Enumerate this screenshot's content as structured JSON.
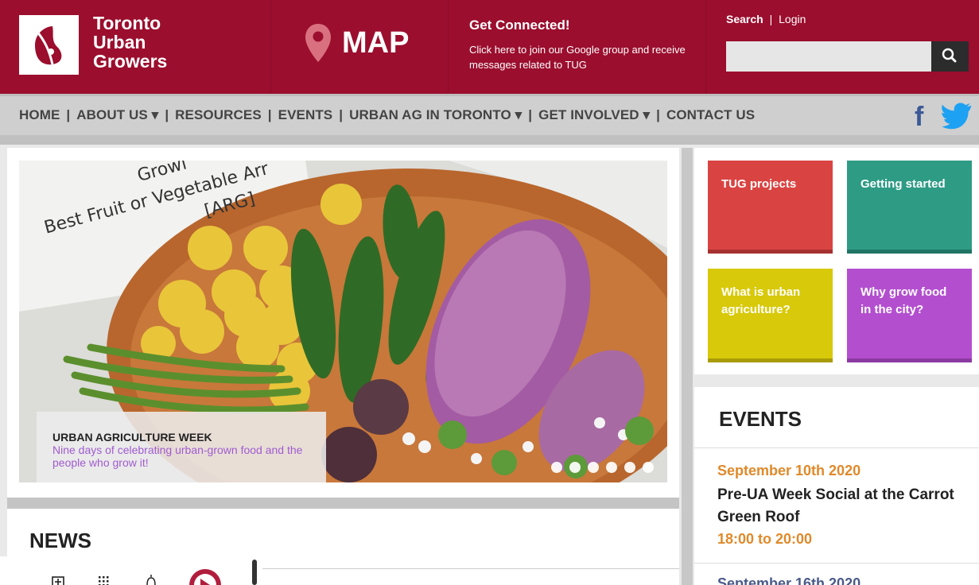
{
  "header": {
    "logo_lines": [
      "Toronto",
      "Urban",
      "Growers"
    ],
    "map_label": "MAP",
    "connect_title": "Get Connected!",
    "connect_body": "Click here to join our Google group and receive messages related to TUG",
    "search_link": "Search",
    "auth_sep": "|",
    "login_link": "Login",
    "search_placeholder": ""
  },
  "nav": {
    "items": [
      "HOME",
      "ABOUT US ▾",
      "RESOURCES",
      "EVENTS",
      "URBAN AG IN TORONTO ▾",
      "GET INVOLVED ▾",
      "CONTACT US"
    ],
    "facebook": "f"
  },
  "hero": {
    "sign_line1": "Growi",
    "sign_line2": "Best Fruit or Vegetable Arr",
    "sign_line3": "[ARG]",
    "caption_title": "URBAN AGRICULTURE WEEK",
    "caption_sub": "Nine days of celebrating urban-grown food and the people who grow it!",
    "slide_count": 6
  },
  "tiles": [
    {
      "label": "TUG projects",
      "color": "#d94442"
    },
    {
      "label": "Getting started",
      "color": "#2e9b85"
    },
    {
      "label": "What is urban agriculture?",
      "color": "#d8c90a"
    },
    {
      "label": "Why grow food in the city?",
      "color": "#b34fcf"
    }
  ],
  "news": {
    "title": "NEWS"
  },
  "events": {
    "title": "EVENTS",
    "items": [
      {
        "date": "September 10th 2020",
        "title": "Pre-UA Week Social at the Carrot Green Roof",
        "time": "18:00 to 20:00"
      },
      {
        "date": "September 16th 2020"
      }
    ]
  },
  "colors": {
    "brand": "#9b0e2e",
    "nav_bg": "#cfcfcf",
    "event_date": "#e0892a"
  },
  "icons": [
    "logo-leaf-icon",
    "map-pin-icon",
    "search-icon",
    "facebook-icon",
    "twitter-icon",
    "add-tab-icon",
    "apps-grid-icon",
    "notification-icon",
    "app-avatar-icon"
  ]
}
